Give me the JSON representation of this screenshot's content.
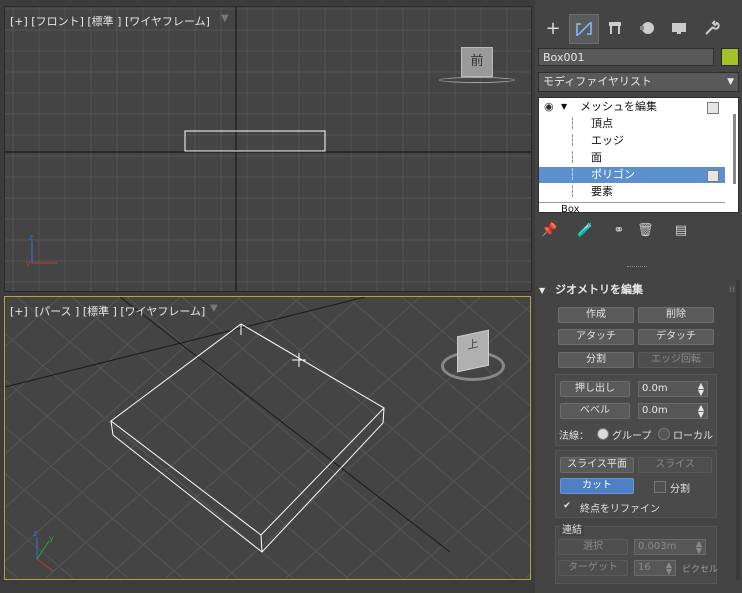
{
  "viewport_front": {
    "label": "[+] [フロント] [標準 ] [ワイヤフレーム]",
    "viewcube_label": "前"
  },
  "viewport_persp": {
    "label": "[+]  [パース ] [標準 ] [ワイヤフレーム]",
    "viewcube_label": "上"
  },
  "command_panel": {
    "tabs": [
      "create-icon",
      "modify-icon",
      "hierarchy-icon",
      "motion-icon",
      "display-icon",
      "utilities-icon"
    ],
    "object_name": "Box001",
    "object_color": "#a3c228",
    "modifier_list": "モディファイヤリスト",
    "stack": {
      "modifier": "メッシュを編集",
      "subobjects": [
        "頂点",
        "エッジ",
        "面",
        "ポリゴン",
        "要素"
      ],
      "selected": "ポリゴン",
      "base": "Box"
    },
    "rollout_title": "ジオメトリを編集",
    "buttons": {
      "create": "作成",
      "delete": "削除",
      "attach": "アタッチ",
      "detach": "デタッチ",
      "divide": "分割",
      "turn_edge": "エッジ回転",
      "extrude": "押し出し",
      "bevel": "ベベル",
      "slice_plane": "スライス平面",
      "slice": "スライス",
      "cut": "カット",
      "select": "選択",
      "target": "ターゲット"
    },
    "extrude_value": "0.0m",
    "bevel_value": "0.0m",
    "normal_label": "法線：",
    "normal_group": "グループ",
    "normal_local": "ローカル",
    "split_label": "分割",
    "refine_ends_label": "終点をリファイン",
    "weld_label": "連結",
    "weld_select_value": "0.003m",
    "weld_target_value": "16",
    "pixels_label": "ピクセル"
  },
  "accent_colors": {
    "active_viewport_border": "#b8a040",
    "selection_blue": "#5c8fd0"
  }
}
